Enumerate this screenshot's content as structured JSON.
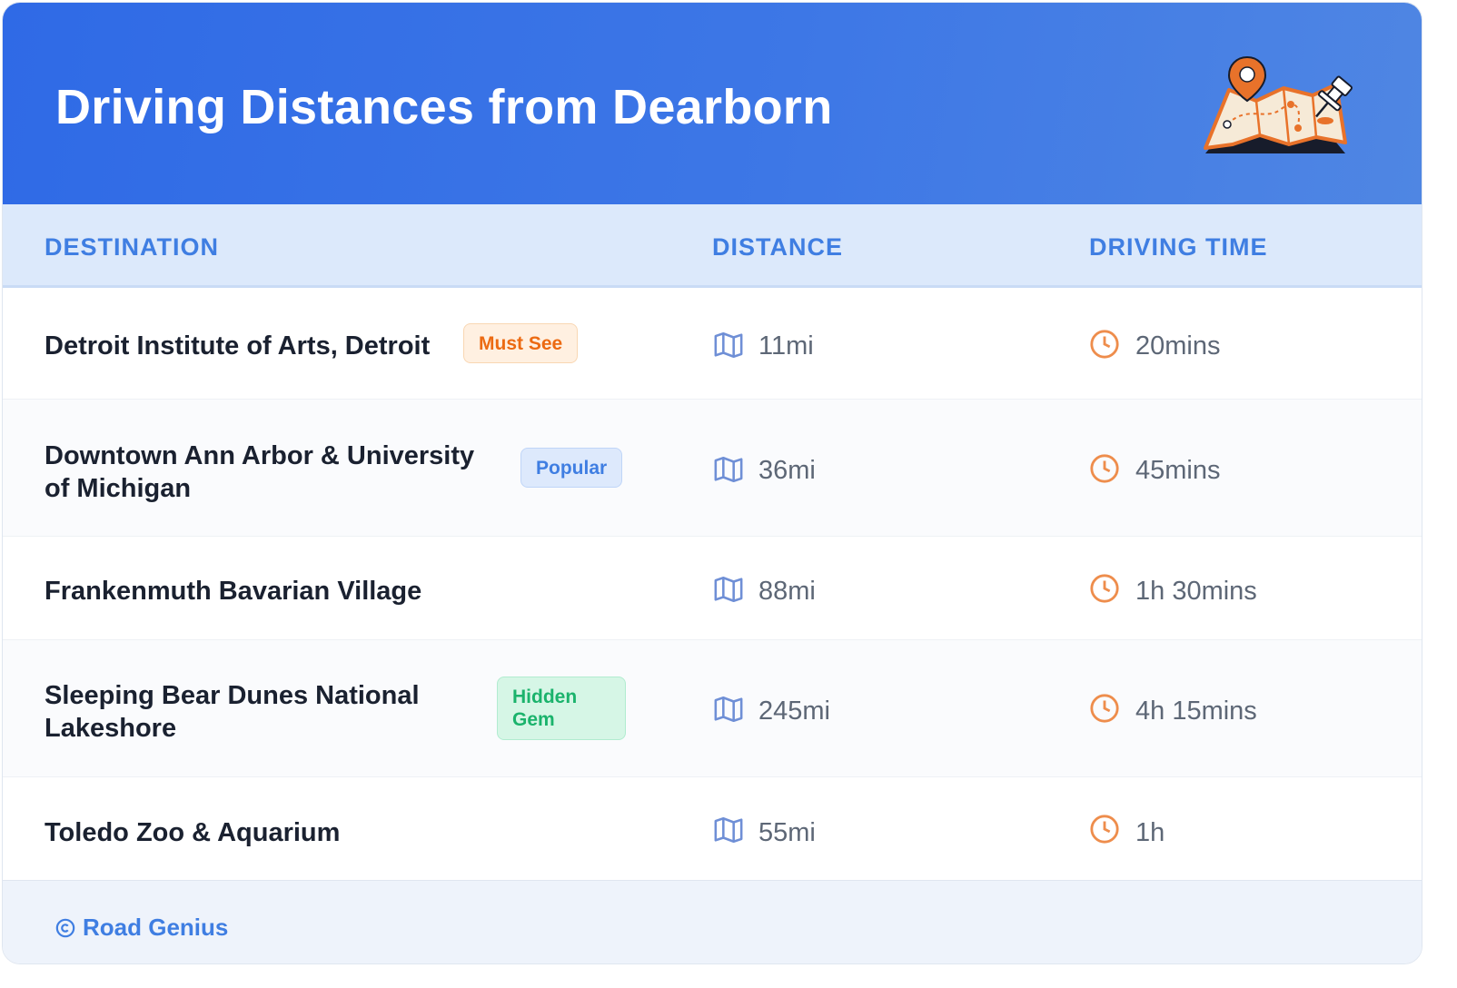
{
  "header": {
    "title": "Driving Distances from Dearborn",
    "illustration": "map-with-pin-illustration"
  },
  "columns": {
    "destination": "DESTINATION",
    "distance": "DISTANCE",
    "driving_time": "DRIVING TIME"
  },
  "rows": [
    {
      "destination": "Detroit Institute of Arts, Detroit",
      "badge": "Must See",
      "badge_color": "#ec6a12",
      "distance": "11mi",
      "time": "20mins"
    },
    {
      "destination": "Downtown Ann Arbor & University of Michigan",
      "badge": "Popular",
      "badge_color": "#3f7ee2",
      "distance": "36mi",
      "time": "45mins"
    },
    {
      "destination": "Frankenmuth Bavarian Village",
      "badge": "",
      "distance": "88mi",
      "time": "1h 30mins"
    },
    {
      "destination": "Sleeping Bear Dunes National Lakeshore",
      "badge": "Hidden Gem",
      "badge_color": "#1bb36c",
      "distance": "245mi",
      "time": "4h 15mins"
    },
    {
      "destination": "Toledo Zoo & Aquarium",
      "badge": "",
      "distance": "55mi",
      "time": "1h"
    }
  ],
  "icons": {
    "distance": "map-icon",
    "time": "clock-icon",
    "footer": "copyright-icon"
  },
  "footer": {
    "text": "Road Genius"
  },
  "colors": {
    "header_gradient_start": "#2f6ae6",
    "header_gradient_end": "#4f86e3",
    "accent_blue": "#3f7ee2",
    "accent_orange": "#ec6a12",
    "accent_green": "#1bb36c"
  }
}
